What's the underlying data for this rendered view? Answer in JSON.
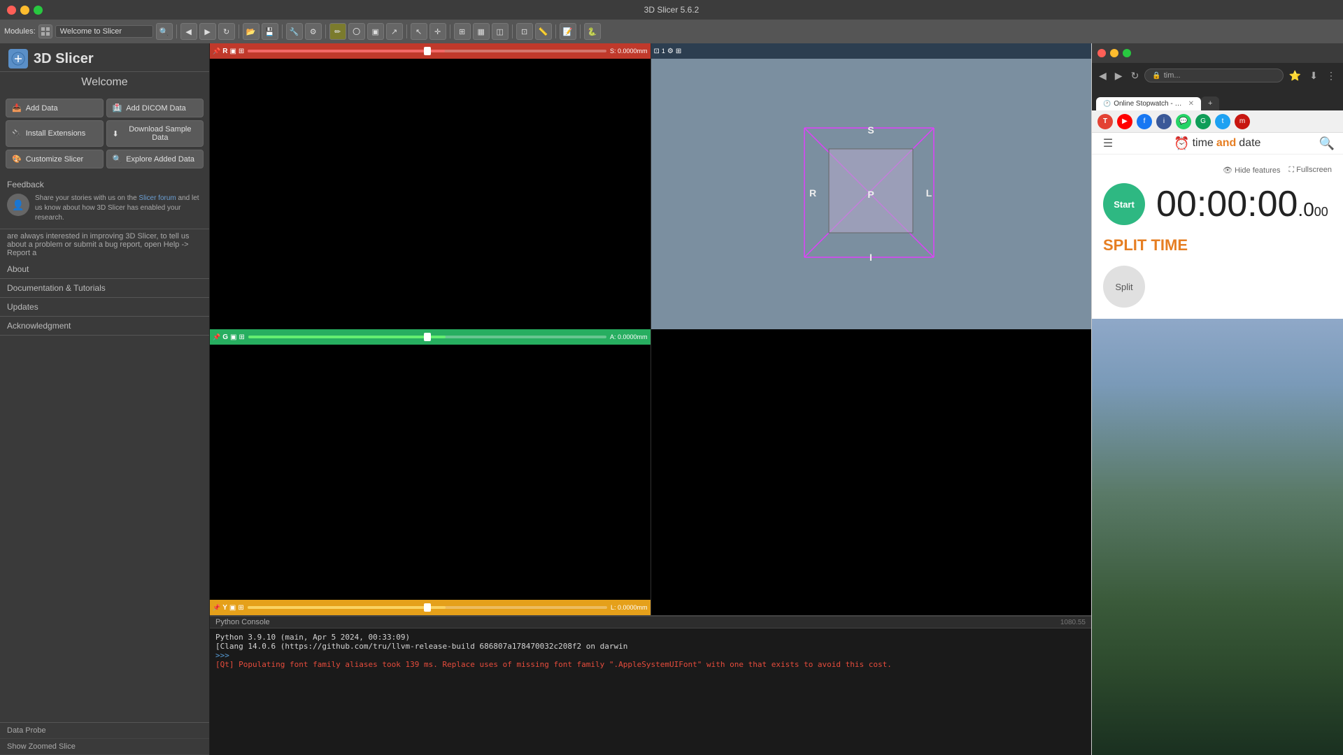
{
  "titlebar": {
    "title": "3D Slicer 5.6.2"
  },
  "slicer": {
    "app_title": "3D Slicer",
    "welcome": "Welcome",
    "modules_label": "Modules:",
    "module_name": "Welcome to Slicer",
    "buttons": {
      "add_data": "Add Data",
      "add_dicom": "Add DICOM Data",
      "install_extensions": "Install Extensions",
      "download_sample": "Download Sample Data",
      "customize_slicer": "Customize Slicer",
      "explore_added": "Explore Added Data"
    },
    "sections": {
      "feedback_title": "Feedback",
      "feedback_text": "Share your stories with us on the ",
      "feedback_link": "Slicer forum",
      "feedback_text2": " and let us know about how 3D Slicer has enabled your research.",
      "improving_text": "are always interested in improving 3D Slicer, to tell us about a problem or submit a bug report, open Help -> Report a",
      "about": "About",
      "docs": "Documentation & Tutorials",
      "updates": "Updates",
      "acknowledgment": "Acknowledgment"
    },
    "slice_views": {
      "red": {
        "label": "R",
        "value": "S: 0.0000mm",
        "coord_label": "R",
        "coord_value": ""
      },
      "green": {
        "label": "G",
        "value": "A: 0.0000mm",
        "coord_label2": "Y",
        "coord_value2": "L: 0.0000mm"
      },
      "yellow": {
        "label": "Y",
        "value": "L: 0.0000mm"
      }
    },
    "view_3d": {
      "label_s": "S",
      "label_r": "R",
      "label_p": "P",
      "label_l": "L",
      "label_i": "I"
    },
    "console": {
      "title": "Python Console",
      "line1": "Python 3.9.10 (main, Apr  5 2024, 00:33:09)",
      "line2": "[Clang 14.0.6 (https://github.com/tru/llvm-release-build 686807a178470032c208f2 on darwin",
      "prompt": ">>> ",
      "error_line": "[Qt] Populating font family aliases took 139 ms. Replace uses of missing font family \".AppleSystemUIFont\" with one that exists to avoid this cost."
    },
    "bottom": {
      "data_probe": "Data Probe",
      "show_zoomed": "Show Zoomed Slice"
    }
  },
  "browser": {
    "tab_title": "Online Stopwatch - easy to u",
    "address": "tim...",
    "stopwatch": {
      "time": "00:00:00",
      "hundredths": ".0",
      "hundredths_sub": "00",
      "start_label": "Start",
      "split_label": "SPLIT TIME",
      "split_btn": "Split",
      "hide_features": "Hide features",
      "fullscreen": "Fullscreen"
    },
    "logo": {
      "time_text": "time",
      "and_text": "and",
      "date_text": "date"
    },
    "new_tab_title": "+"
  }
}
